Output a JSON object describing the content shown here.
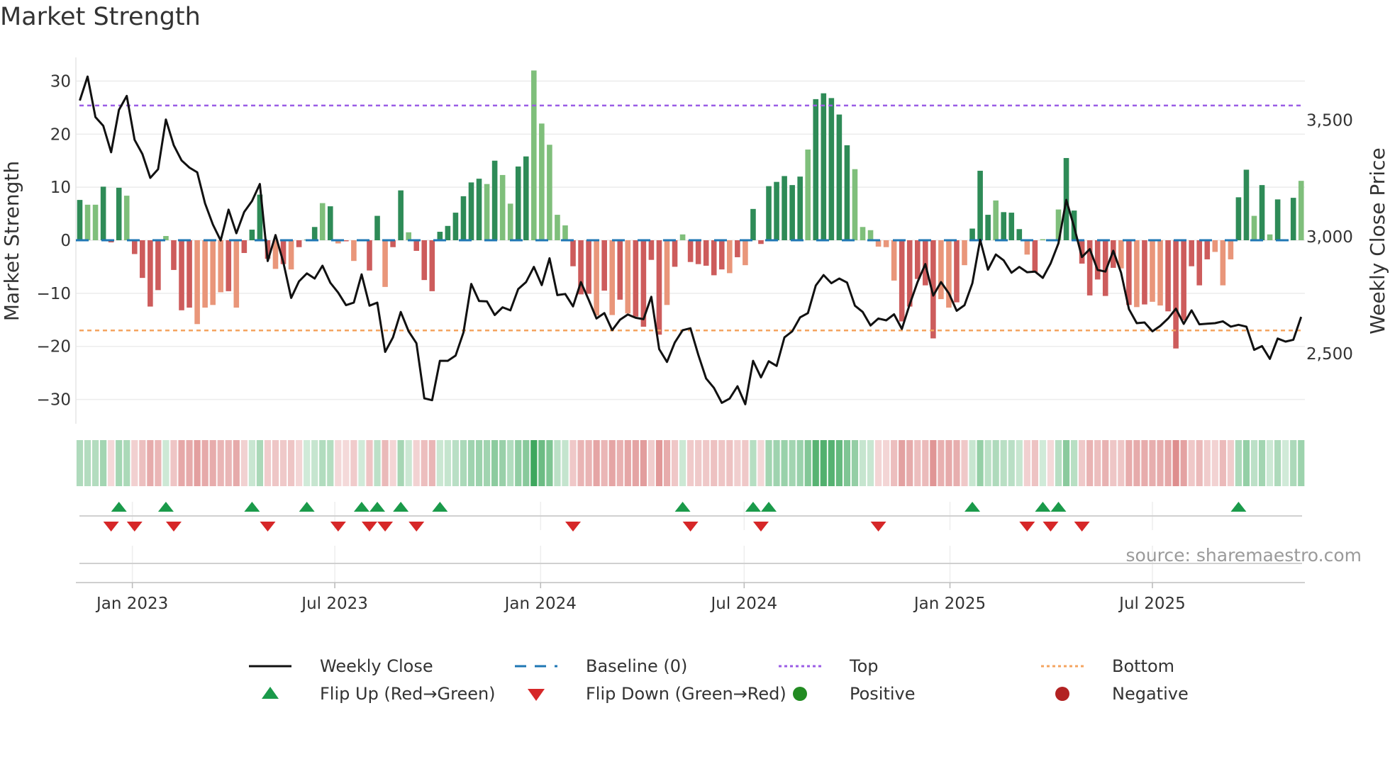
{
  "title": "Market Strength",
  "source": "source: sharemaestro.com",
  "colors": {
    "pos_dark": "#2e8b57",
    "pos_light": "#7fbf7b",
    "neg_dark": "#cd5c5c",
    "neg_light": "#e9967a",
    "baseline": "#1f77b4",
    "top": "#9b5de5",
    "bottom": "#f4a460",
    "close": "#111111",
    "flip_up": "#1a9a4a",
    "flip_down": "#d62728",
    "positive": "#228b22",
    "negative": "#b22222"
  },
  "legend": [
    {
      "key": "close",
      "label": "Weekly Close"
    },
    {
      "key": "baseline",
      "label": "Baseline (0)"
    },
    {
      "key": "top",
      "label": "Top"
    },
    {
      "key": "bottom",
      "label": "Bottom"
    },
    {
      "key": "flip_up",
      "label": "Flip Up (Red→Green)"
    },
    {
      "key": "flip_down",
      "label": "Flip Down (Green→Red)"
    },
    {
      "key": "positive",
      "label": "Positive"
    },
    {
      "key": "negative",
      "label": "Negative"
    }
  ],
  "chart_data": {
    "type": "bar",
    "title": "Market Strength",
    "ylabel": "Market Strength",
    "y2label": "Weekly Close Price",
    "ylim": [
      -35,
      35
    ],
    "y2lim": [
      2190,
      3780
    ],
    "yticks": [
      {
        "v": 30,
        "label": "30"
      },
      {
        "v": 20,
        "label": "20"
      },
      {
        "v": 10,
        "label": "10"
      },
      {
        "v": 0,
        "label": "0"
      },
      {
        "v": -10,
        "label": "−10"
      },
      {
        "v": -20,
        "label": "−20"
      },
      {
        "v": -30,
        "label": "−30"
      }
    ],
    "y2ticks": [
      {
        "v": 3500,
        "label": "3,500"
      },
      {
        "v": 3000,
        "label": "3,000"
      },
      {
        "v": 2500,
        "label": "2,500"
      }
    ],
    "xticks": [
      {
        "date": "2023-01-01",
        "label": "Jan 2023"
      },
      {
        "date": "2023-07-01",
        "label": "Jul 2023"
      },
      {
        "date": "2024-01-01",
        "label": "Jan 2024"
      },
      {
        "date": "2024-07-01",
        "label": "Jul 2024"
      },
      {
        "date": "2025-01-01",
        "label": "Jan 2025"
      },
      {
        "date": "2025-07-01",
        "label": "Jul 2025"
      }
    ],
    "start_date": "2022-11-15",
    "frequency": "weekly",
    "top_level": 25.4,
    "bottom_level": -17.0,
    "baseline": 0,
    "strength": [
      7.6,
      6.7,
      6.7,
      10.1,
      -0.4,
      9.9,
      8.4,
      -2.6,
      -7.1,
      -12.5,
      -9.4,
      0.8,
      -5.6,
      -13.2,
      -12.7,
      -15.8,
      -12.7,
      -12.2,
      -9.8,
      -9.6,
      -12.7,
      -2.4,
      2.0,
      8.6,
      -3.5,
      -5.4,
      -4.5,
      -5.5,
      -1.3,
      0.1,
      2.5,
      7.0,
      6.4,
      -0.6,
      -0.2,
      -3.9,
      0.2,
      -5.7,
      4.6,
      -8.8,
      -1.3,
      9.4,
      1.5,
      -2.0,
      -7.5,
      -9.6,
      1.6,
      2.7,
      5.2,
      8.3,
      10.9,
      11.6,
      10.6,
      15.0,
      12.3,
      6.9,
      13.9,
      15.8,
      32.0,
      22.0,
      18.0,
      4.8,
      2.8,
      -4.9,
      -10.2,
      -10.1,
      -14.2,
      -9.5,
      -14.1,
      -11.2,
      -13.8,
      -14.4,
      -16.3,
      -3.7,
      -17.8,
      -12.2,
      -5.0,
      1.1,
      -4.1,
      -4.5,
      -4.8,
      -6.6,
      -5.5,
      -6.2,
      -3.2,
      -4.7,
      5.9,
      -0.7,
      10.2,
      11.0,
      12.1,
      10.4,
      12.0,
      17.1,
      26.6,
      27.7,
      26.8,
      23.7,
      17.9,
      13.4,
      2.5,
      1.9,
      -1.2,
      -1.3,
      -7.6,
      -15.3,
      -12.5,
      -7.3,
      -8.5,
      -18.5,
      -11.1,
      -12.7,
      -11.7,
      -4.7,
      2.2,
      13.1,
      4.8,
      7.5,
      5.3,
      5.2,
      2.1,
      -2.7,
      -6.0,
      0.2,
      -0.2,
      5.8,
      15.5,
      5.6,
      -4.4,
      -10.4,
      -7.4,
      -10.5,
      -5.2,
      -5.3,
      -12.2,
      -12.6,
      -12.1,
      -11.6,
      -12.3,
      -13.4,
      -20.4,
      -15.1,
      -4.9,
      -8.5,
      -3.6,
      -2.2,
      -8.5,
      -3.6,
      8.1,
      13.3,
      4.6,
      10.4,
      1.1,
      7.7,
      0.1,
      8.0,
      11.2
    ],
    "shade": "dlldddlddddldddlllldlddddldldddldldldddlddldddddddddldllddllllldddldldlddddldldddddldldddddddldddddlllllldddddlldldddldddldllldddddddldldllddddddlllddldldldlldlddldld",
    "close": [
      3583,
      3686,
      3512,
      3475,
      3362,
      3543,
      3603,
      3415,
      3354,
      3252,
      3289,
      3502,
      3392,
      3327,
      3296,
      3276,
      3143,
      3052,
      2984,
      3116,
      3015,
      3106,
      3153,
      3226,
      2896,
      3007,
      2891,
      2738,
      2809,
      2843,
      2821,
      2876,
      2803,
      2761,
      2707,
      2718,
      2839,
      2705,
      2718,
      2507,
      2569,
      2678,
      2595,
      2544,
      2308,
      2300,
      2469,
      2469,
      2491,
      2590,
      2798,
      2725,
      2723,
      2665,
      2698,
      2685,
      2776,
      2806,
      2871,
      2793,
      2908,
      2750,
      2755,
      2702,
      2806,
      2730,
      2650,
      2673,
      2600,
      2645,
      2667,
      2653,
      2647,
      2743,
      2519,
      2464,
      2547,
      2600,
      2608,
      2494,
      2393,
      2353,
      2289,
      2307,
      2360,
      2283,
      2469,
      2398,
      2467,
      2447,
      2569,
      2595,
      2655,
      2673,
      2791,
      2836,
      2801,
      2821,
      2804,
      2705,
      2678,
      2620,
      2650,
      2642,
      2668,
      2605,
      2710,
      2806,
      2883,
      2748,
      2806,
      2758,
      2683,
      2707,
      2801,
      2987,
      2859,
      2924,
      2899,
      2846,
      2871,
      2848,
      2851,
      2824,
      2886,
      2972,
      3158,
      3042,
      2913,
      2947,
      2858,
      2851,
      2940,
      2846,
      2690,
      2630,
      2633,
      2595,
      2618,
      2650,
      2692,
      2627,
      2685,
      2625,
      2628,
      2630,
      2638,
      2615,
      2623,
      2615,
      2516,
      2532,
      2477,
      2564,
      2551,
      2559,
      2657
    ]
  }
}
